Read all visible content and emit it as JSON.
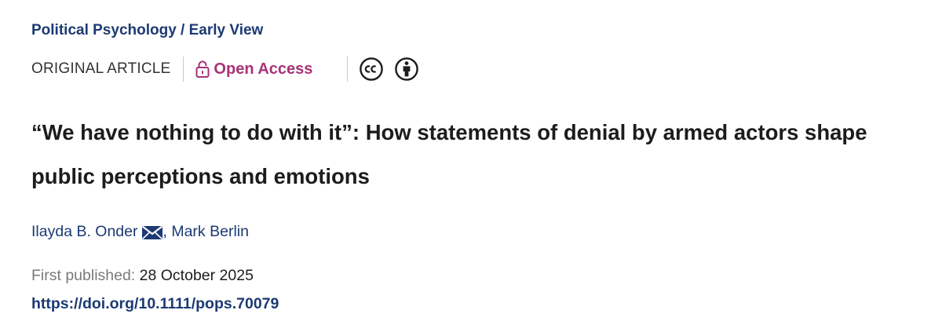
{
  "journal": {
    "name": "Political Psychology",
    "separator": " / ",
    "issue": "Early View"
  },
  "article": {
    "type": "ORIGINAL ARTICLE",
    "open_access_label": "Open Access",
    "license_icons": [
      "creative-commons-icon",
      "attribution-icon"
    ],
    "title": "“We have nothing to do with it”: How statements of denial by armed actors shape public perceptions and emotions",
    "authors": [
      "Ilayda B. Onder",
      "Mark Berlin"
    ],
    "author_separator": ", ",
    "published_label": "First published:",
    "published_date": "28 October 2025",
    "doi": "https://doi.org/10.1111/pops.70079"
  },
  "colors": {
    "link_blue": "#1c3a73",
    "open_access_magenta": "#a83277",
    "muted_gray": "#7a7a7a",
    "text_dark": "#1c1c1c"
  }
}
